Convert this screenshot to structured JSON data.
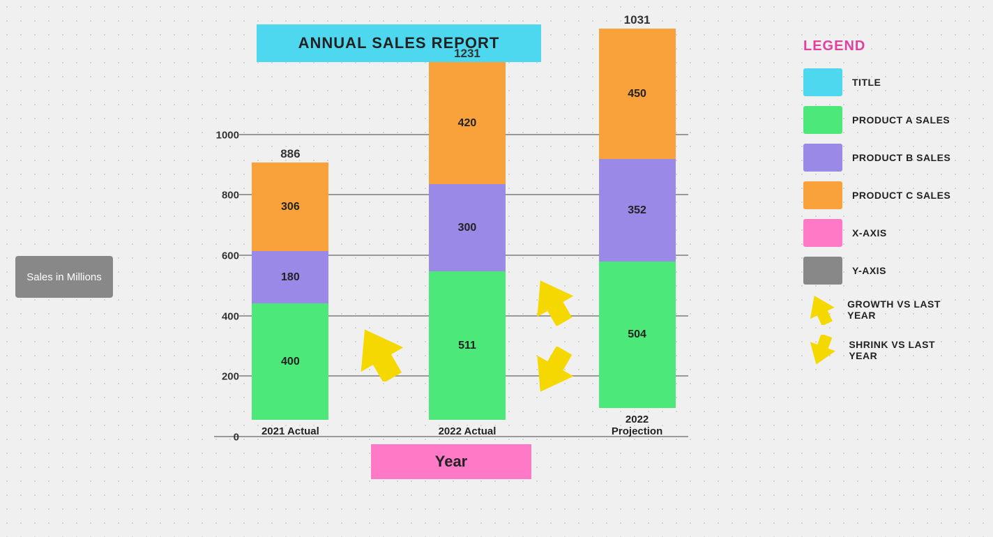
{
  "title": "ANNUAL SALES REPORT",
  "xAxisLabel": "Year",
  "yAxisLabel": "Sales in Millions",
  "colors": {
    "title": "#4dd8f0",
    "productA": "#4de87a",
    "productB": "#9b89e8",
    "productC": "#f9a13a",
    "xAxis": "#ff79c6",
    "yAxis": "#888888",
    "growth": "#f5d800",
    "shrink": "#f5d800"
  },
  "yAxisTicks": [
    0,
    200,
    400,
    600,
    800,
    1000
  ],
  "bars": [
    {
      "label": "2021 Actual",
      "total": 886,
      "segments": [
        {
          "value": 400,
          "color": "#4de87a"
        },
        {
          "value": 180,
          "color": "#9b89e8"
        },
        {
          "value": 306,
          "color": "#f9a13a"
        }
      ]
    },
    {
      "label": "2022 Actual",
      "total": 1231,
      "segments": [
        {
          "value": 511,
          "color": "#4de87a"
        },
        {
          "value": 300,
          "color": "#9b89e8"
        },
        {
          "value": 420,
          "color": "#f9a13a"
        }
      ]
    },
    {
      "label": "2022 Projection",
      "total": 1031,
      "segments": [
        {
          "value": 504,
          "color": "#4de87a"
        },
        {
          "value": 352,
          "color": "#9b89e8"
        },
        {
          "value": 450,
          "color": "#f9a13a"
        }
      ]
    }
  ],
  "legend": {
    "title": "LEGEND",
    "items": [
      {
        "type": "color",
        "color": "#4dd8f0",
        "label": "TITLE"
      },
      {
        "type": "color",
        "color": "#4de87a",
        "label": "PRODUCT A SALES"
      },
      {
        "type": "color",
        "color": "#9b89e8",
        "label": "PRODUCT B SALES"
      },
      {
        "type": "color",
        "color": "#f9a13a",
        "label": "PRODUCT C SALES"
      },
      {
        "type": "color",
        "color": "#ff79c6",
        "label": "X-AXIS"
      },
      {
        "type": "color",
        "color": "#888888",
        "label": "Y-AXIS"
      },
      {
        "type": "arrow-up",
        "label": "GROWTH VS LAST YEAR"
      },
      {
        "type": "arrow-down",
        "label": "SHRINK VS LAST YEAR"
      }
    ]
  }
}
